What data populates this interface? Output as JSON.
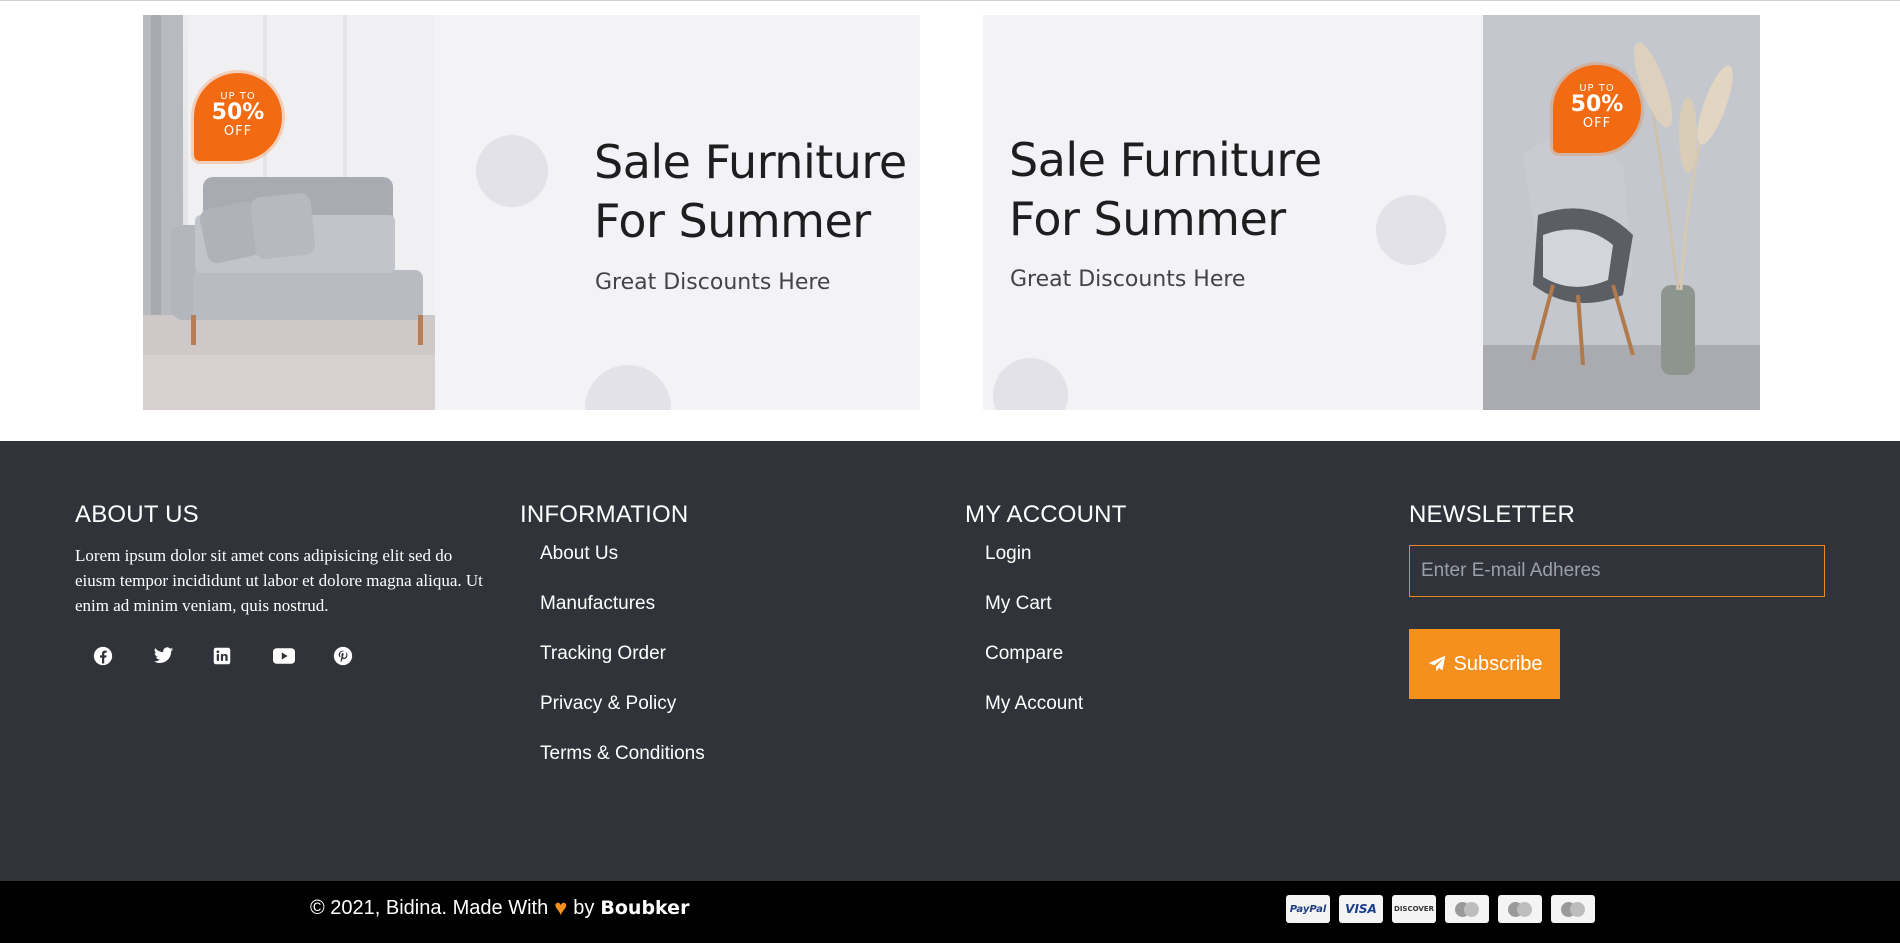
{
  "banners": [
    {
      "title_line1": "Sale Furniture",
      "title_line2": "For Summer",
      "subtitle": "Great Discounts Here",
      "badge": {
        "top": "UP TO",
        "value": "50%",
        "bottom": "OFF"
      }
    },
    {
      "title_line1": "Sale Furniture",
      "title_line2": "For Summer",
      "subtitle": "Great Discounts Here",
      "badge": {
        "top": "UP TO",
        "value": "50%",
        "bottom": "OFF"
      }
    }
  ],
  "footer": {
    "about": {
      "heading": "ABOUT US",
      "text": "Lorem ipsum dolor sit amet cons adipisicing elit sed do eiusm tempor incididunt ut labor et dolore magna aliqua. Ut enim ad minim veniam, quis nostrud.",
      "social": [
        "facebook-icon",
        "twitter-icon",
        "linkedin-icon",
        "youtube-icon",
        "pinterest-icon"
      ]
    },
    "information": {
      "heading": "INFORMATION",
      "links": [
        "About Us",
        "Manufactures",
        "Tracking Order",
        "Privacy & Policy",
        "Terms & Conditions"
      ]
    },
    "account": {
      "heading": "MY ACCOUNT",
      "links": [
        "Login",
        "My Cart",
        "Compare",
        "My Account"
      ]
    },
    "newsletter": {
      "heading": "NEWSLETTER",
      "placeholder": "Enter E-mail Adheres",
      "button": "Subscribe"
    }
  },
  "bottom": {
    "copyright_prefix": "© 2021, Bidina. Made With",
    "by": "by",
    "author": "Boubker",
    "payments": [
      "PayPal",
      "VISA",
      "DISCOVER",
      "MasterCard",
      "Cirrus",
      "Maestro"
    ]
  },
  "colors": {
    "footer_bg": "#30343a",
    "accent": "#f5901e",
    "badge": "#f26b12",
    "bottom_bg": "#000000"
  }
}
